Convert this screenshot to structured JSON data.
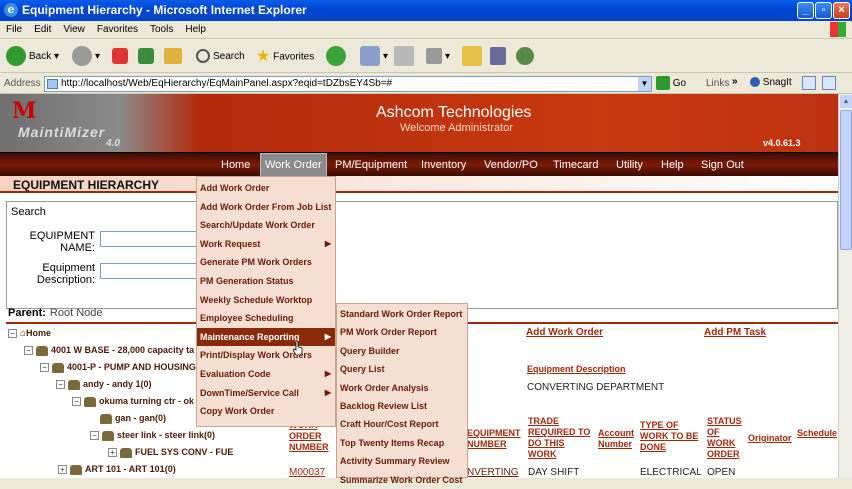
{
  "window": {
    "title": "Equipment Hierarchy - Microsoft Internet Explorer",
    "buttons": [
      "_",
      "▫",
      "×"
    ]
  },
  "ie_menu": [
    "File",
    "Edit",
    "View",
    "Favorites",
    "Tools",
    "Help"
  ],
  "ie_toolbar": {
    "back": "Back",
    "search": "Search",
    "favorites": "Favorites",
    "links": "Links",
    "snagit": "SnagIt",
    "go": "Go"
  },
  "address": {
    "label": "Address",
    "url": "http://localhost/Web/EqHierarchy/EqMainPanel.aspx?eqid=tDZbsEY4Sb=#"
  },
  "app": {
    "logo_name": "MaintiMizer",
    "logo_version": "4.0",
    "company": "Ashcom Technologies",
    "welcome": "Welcome Administrator",
    "version": "v4.0.61.3"
  },
  "nav": [
    "Home",
    "Work Order",
    "PM/Equipment",
    "Inventory",
    "Vendor/PO",
    "Timecard",
    "Utility",
    "Help",
    "Sign Out"
  ],
  "page": {
    "title": "EQUIPMENT HIERARCHY",
    "search_title": "Search",
    "eq_name_label_1": "EQUIPMENT",
    "eq_name_label_2": "NAME:",
    "eq_desc_label_1": "Equipment",
    "eq_desc_label_2": "Description:",
    "parent_label": "Parent:",
    "parent_value": "Root Node"
  },
  "tree": [
    "Home",
    "4001 W BASE - 28,000 capacity ta",
    "4001-P - PUMP AND HOUSING",
    "andy - andy 1(0)",
    "okuma turning ctr - ok",
    "gan - gan(0)",
    "steer link - steer link(0)",
    "FUEL SYS CONV - FUE",
    "ART 101 - ART 101(0)"
  ],
  "right_panel": {
    "add_work_order": "Add Work Order",
    "add_pm_task": "Add PM Task",
    "eq_desc_header": "Equipment Description",
    "eq_desc_value": "CONVERTING DEPARTMENT",
    "col_wo_number": "WORK ORDER NUMBER",
    "col_equipment": "EQUIPMENT NUMBER",
    "col_trade": "TRADE REQUIRED TO DO THIS WORK",
    "col_account": "Account Number",
    "col_type": "TYPE OF WORK TO BE DONE",
    "col_status": "STATUS OF WORK ORDER",
    "col_originator": "Originator",
    "col_schedule": "Schedule Date",
    "row_wo": "M00037",
    "row_equipment": "NVERTING",
    "row_trade": "DAY SHIFT",
    "row_type": "ELECTRICAL",
    "row_status": "OPEN"
  },
  "work_order_menu": [
    {
      "label": "Add Work Order",
      "sub": false
    },
    {
      "label": "Add Work Order From Job List",
      "sub": false
    },
    {
      "label": "Search/Update Work Order",
      "sub": false
    },
    {
      "label": "Work Request",
      "sub": true
    },
    {
      "label": "Generate PM Work Orders",
      "sub": false
    },
    {
      "label": "PM Generation Status",
      "sub": false
    },
    {
      "label": "Weekly Schedule Worktop",
      "sub": false
    },
    {
      "label": "Employee Scheduling",
      "sub": false
    },
    {
      "label": "Maintenance Reporting",
      "sub": true,
      "highlight": true
    },
    {
      "label": "Print/Display Work Orders",
      "sub": false
    },
    {
      "label": "Evaluation Code",
      "sub": true
    },
    {
      "label": "DownTime/Service Call",
      "sub": true
    },
    {
      "label": "Copy Work Order",
      "sub": false
    }
  ],
  "reporting_menu": [
    "Standard Work Order Report",
    "PM Work Order Report",
    "Query Builder",
    "Query List",
    "Work Order Analysis",
    "Backlog Review List",
    "Craft Hour/Cost Report",
    "Top Twenty Items Recap",
    "Activity Summary Review",
    "Summarize Work Order Cost"
  ],
  "colors": {
    "brand_red": "#a0280c",
    "nav_dark": "#5a1205",
    "menu_bg": "#f4dfd2",
    "menu_highlight": "#8a2a0a"
  }
}
